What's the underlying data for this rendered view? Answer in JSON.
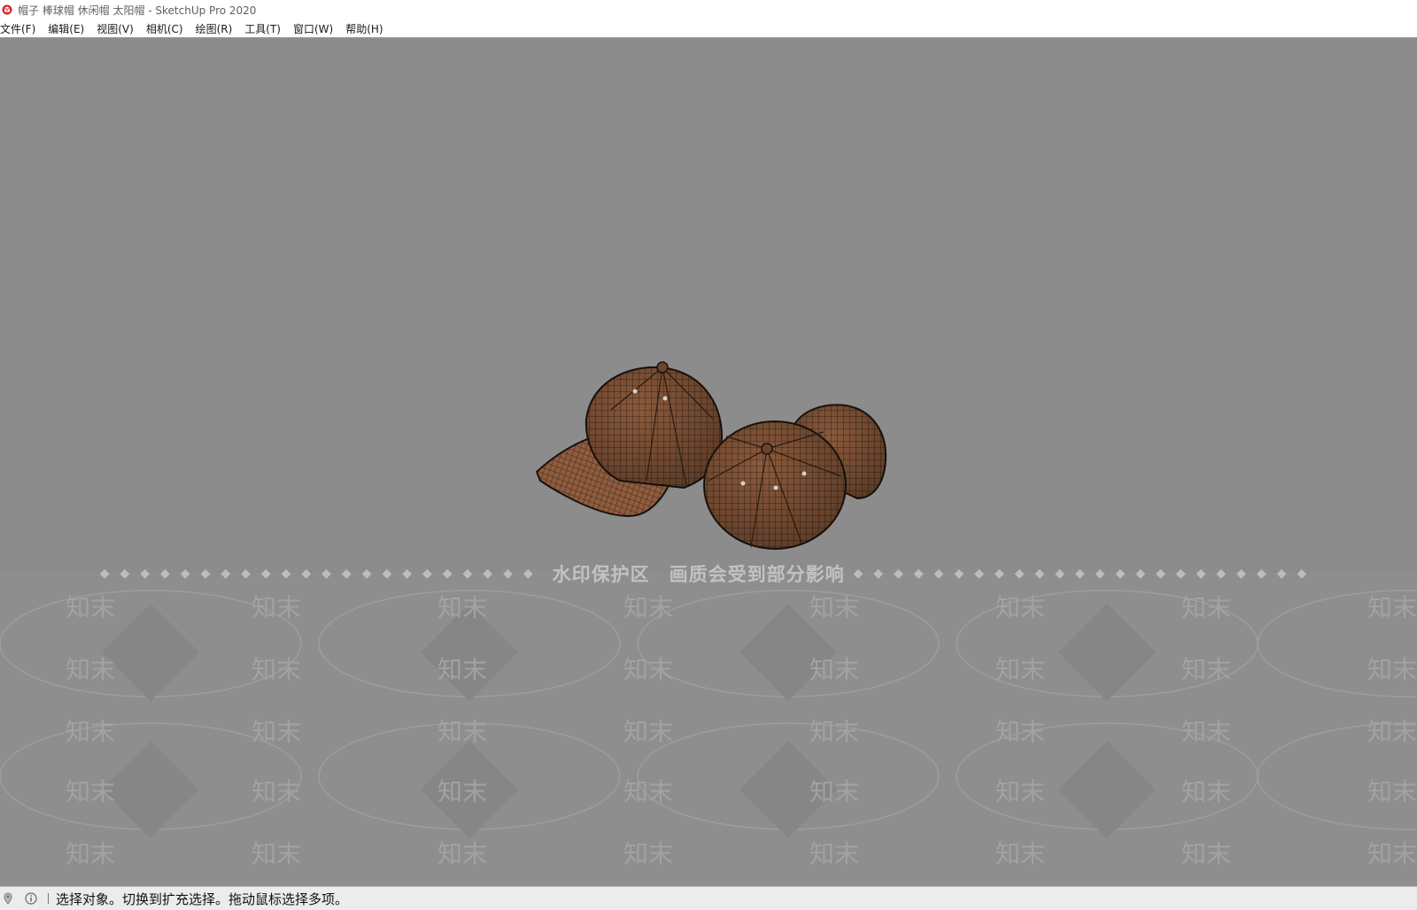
{
  "window": {
    "title": "帽子 棒球帽 休闲帽 太阳帽 - SketchUp Pro 2020",
    "icon": "sketchup-logo-icon"
  },
  "menubar": {
    "items": [
      {
        "label": "文件(F)"
      },
      {
        "label": "编辑(E)"
      },
      {
        "label": "视图(V)"
      },
      {
        "label": "相机(C)"
      },
      {
        "label": "绘图(R)"
      },
      {
        "label": "工具(T)"
      },
      {
        "label": "窗口(W)"
      },
      {
        "label": "帮助(H)"
      }
    ]
  },
  "viewport": {
    "background_color": "#8c8c8c",
    "model_color": "#8b5a3c",
    "watermark": {
      "notice": "水印保护区　画质会受到部分影响",
      "mark": "知末"
    }
  },
  "statusbar": {
    "icons": [
      "geo-location-icon",
      "info-icon"
    ],
    "text": "选择对象。切换到扩充选择。拖动鼠标选择多项。"
  }
}
